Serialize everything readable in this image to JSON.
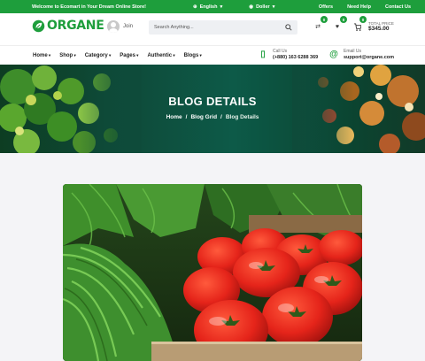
{
  "topbar": {
    "welcome": "Welcome to Ecomart in Your Dream Online Store!",
    "language": "English",
    "currency": "Doller",
    "links": [
      "Offers",
      "Need Help",
      "Contact Us"
    ]
  },
  "header": {
    "logo": "ORGANE",
    "join": "Join",
    "search_placeholder": "Search Anything...",
    "compare_count": "0",
    "wishlist_count": "0",
    "cart_count": "0",
    "total_label": "TOTAL PRICE",
    "total_value": "$345.00"
  },
  "nav": {
    "items": [
      "Home",
      "Shop",
      "Category",
      "Pages",
      "Authentic",
      "Blogs"
    ],
    "call_label": "Call Us",
    "call_value": "(+880) 163 6288 369",
    "email_label": "Email Us",
    "email_value": "support@organe.com"
  },
  "hero": {
    "title": "BLOG DETAILS",
    "breadcrumb": [
      "Home",
      "Blog Grid",
      "Blog Details"
    ]
  },
  "colors": {
    "brand": "#1e9e3c",
    "hero_bg": "#0e4b3a",
    "page_bg": "#f4f4f7"
  },
  "icons": [
    "leaf-logo-icon",
    "globe-icon",
    "currency-icon",
    "user-avatar-icon",
    "search-icon",
    "compare-icon",
    "heart-icon",
    "cart-icon",
    "phone-icon",
    "email-icon"
  ]
}
